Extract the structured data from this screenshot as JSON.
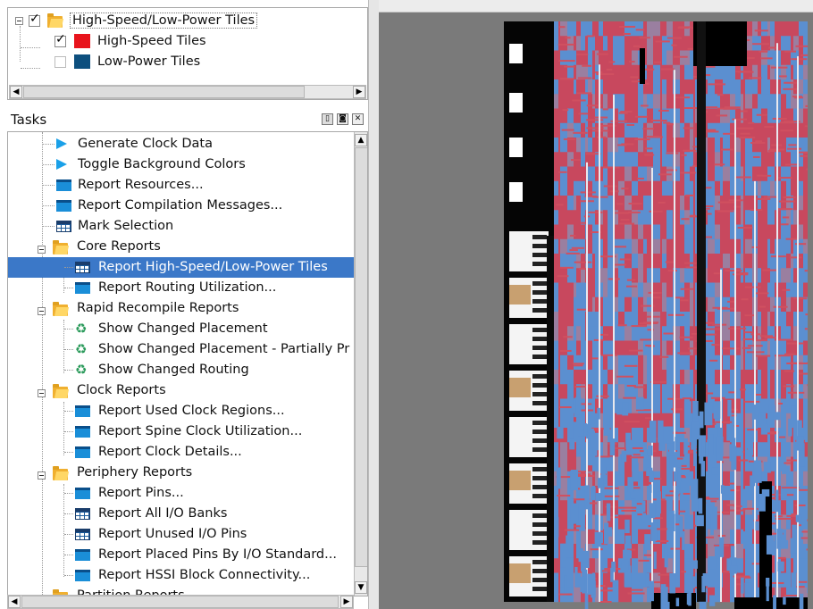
{
  "legend": {
    "group": {
      "label": "High-Speed/Low-Power Tiles",
      "checked": true
    },
    "items": [
      {
        "label": "High-Speed Tiles",
        "checked": true,
        "color": "#e8141c"
      },
      {
        "label": "Low-Power Tiles",
        "checked": false,
        "color": "#0d4f7e"
      }
    ]
  },
  "tasks": {
    "title": "Tasks",
    "rows": [
      {
        "label": "Generate Clock Data",
        "icon": "play-icon",
        "depth": 1
      },
      {
        "label": "Toggle Background Colors",
        "icon": "play-icon",
        "depth": 1
      },
      {
        "label": "Report Resources...",
        "icon": "report-icon",
        "depth": 1
      },
      {
        "label": "Report Compilation Messages...",
        "icon": "report-icon",
        "depth": 1
      },
      {
        "label": "Mark Selection",
        "icon": "table-icon",
        "depth": 1
      },
      {
        "label": "Core Reports",
        "icon": "folder-icon",
        "depth": 0,
        "expander": true
      },
      {
        "label": "Report High-Speed/Low-Power Tiles",
        "icon": "table-icon",
        "depth": 2,
        "selected": true
      },
      {
        "label": "Report Routing Utilization...",
        "icon": "report-icon",
        "depth": 2
      },
      {
        "label": "Rapid Recompile Reports",
        "icon": "folder-icon",
        "depth": 0,
        "expander": true
      },
      {
        "label": "Show Changed Placement",
        "icon": "recycle-icon",
        "depth": 2
      },
      {
        "label": "Show Changed Placement - Partially Pr",
        "icon": "recycle-icon",
        "depth": 2
      },
      {
        "label": "Show Changed Routing",
        "icon": "recycle-icon",
        "depth": 2
      },
      {
        "label": "Clock Reports",
        "icon": "folder-icon",
        "depth": 0,
        "expander": true
      },
      {
        "label": "Report Used Clock Regions...",
        "icon": "report-icon",
        "depth": 2
      },
      {
        "label": "Report Spine Clock Utilization...",
        "icon": "report-icon",
        "depth": 2
      },
      {
        "label": "Report Clock Details...",
        "icon": "report-icon",
        "depth": 2
      },
      {
        "label": "Periphery Reports",
        "icon": "folder-icon",
        "depth": 0,
        "expander": true
      },
      {
        "label": "Report Pins...",
        "icon": "report-icon",
        "depth": 2
      },
      {
        "label": "Report All I/O Banks",
        "icon": "table-icon",
        "depth": 2
      },
      {
        "label": "Report Unused I/O Pins",
        "icon": "table-icon",
        "depth": 2
      },
      {
        "label": "Report Placed Pins By I/O Standard...",
        "icon": "report-icon",
        "depth": 2
      },
      {
        "label": "Report HSSI Block Connectivity...",
        "icon": "report-icon",
        "depth": 2
      },
      {
        "label": "Partition Reports",
        "icon": "folder-icon",
        "depth": 0,
        "expander": true
      }
    ]
  },
  "colors": {
    "selection": "#3b78c8",
    "high_speed": "#c8485e",
    "low_power": "#5b8fd0"
  }
}
